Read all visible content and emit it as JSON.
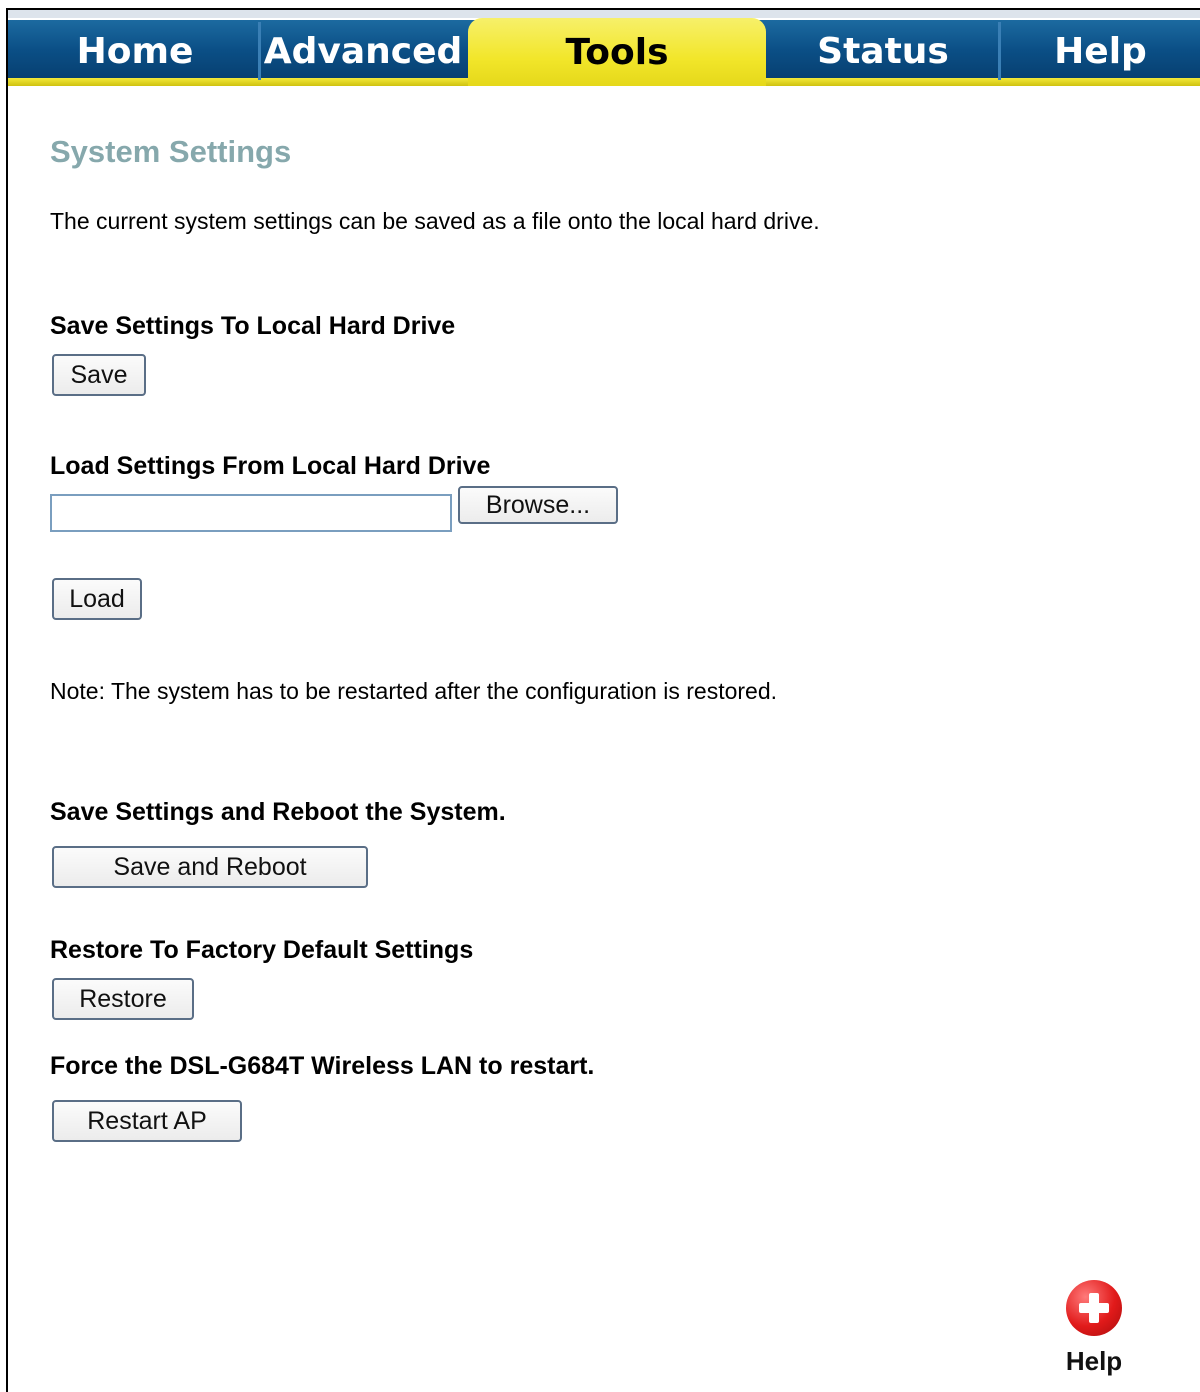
{
  "nav": {
    "tabs": [
      {
        "label": "Home"
      },
      {
        "label": "Advanced"
      },
      {
        "label": "Tools"
      },
      {
        "label": "Status"
      },
      {
        "label": "Help"
      }
    ],
    "active_tab": "Tools"
  },
  "page": {
    "title": "System Settings",
    "description": "The current system settings can be saved as a file onto the local hard drive."
  },
  "save_section": {
    "title": "Save Settings To Local Hard Drive",
    "button": "Save"
  },
  "load_section": {
    "title": "Load Settings From Local Hard Drive",
    "file_value": "",
    "browse_button": "Browse...",
    "load_button": "Load",
    "note": "Note: The system has to be restarted after the configuration is restored."
  },
  "reboot_section": {
    "title": "Save Settings and Reboot the System.",
    "button": "Save and Reboot"
  },
  "restore_section": {
    "title": "Restore To Factory Default Settings",
    "button": "Restore"
  },
  "restart_section": {
    "title": "Force the DSL-G684T Wireless LAN to restart.",
    "button": "Restart AP"
  },
  "help": {
    "icon": "help-plus-icon",
    "label": "Help"
  },
  "colors": {
    "nav_blue": "#0b4f86",
    "nav_yellow": "#f2e62a",
    "title_color": "#86a8ac"
  }
}
